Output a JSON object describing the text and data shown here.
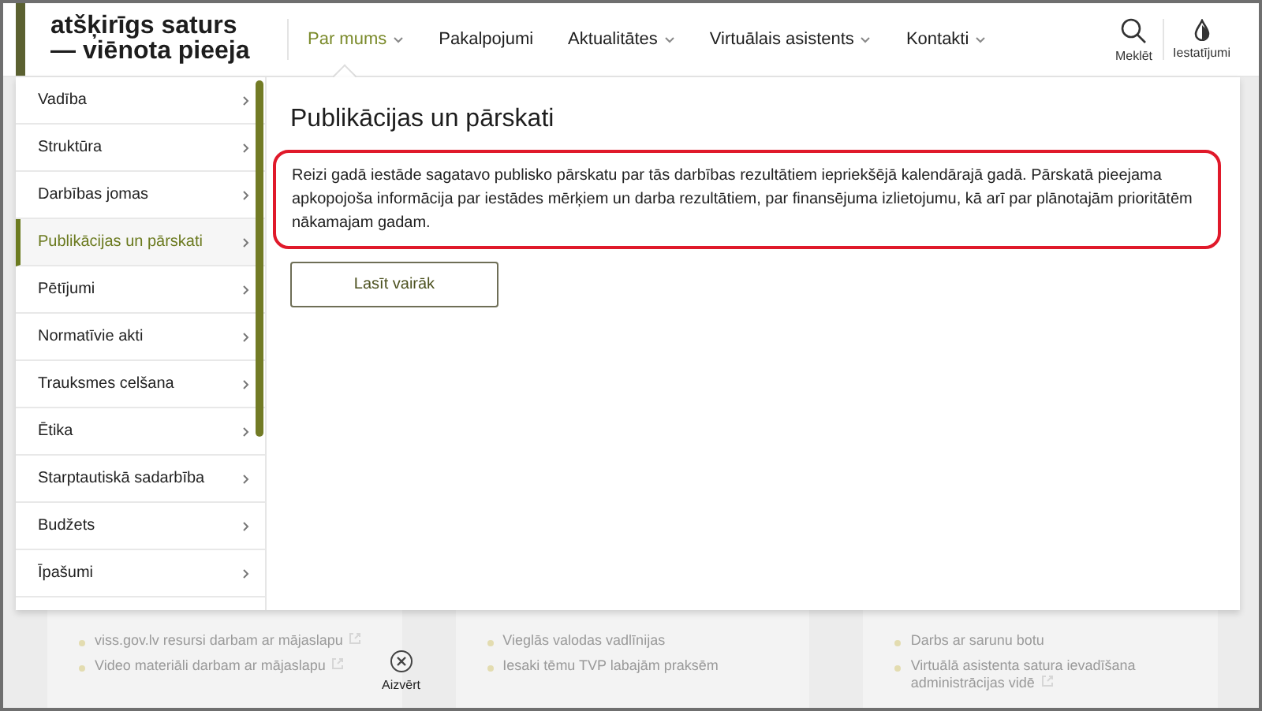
{
  "header": {
    "logo": [
      "atšķirīgs saturs",
      "— viēnota pieeja"
    ],
    "nav": [
      {
        "label": "Par mums",
        "selected": true,
        "dropdown": true
      },
      {
        "label": "Pakalpojumi",
        "selected": false,
        "dropdown": false
      },
      {
        "label": "Aktualitātes",
        "selected": false,
        "dropdown": true
      },
      {
        "label": "Virtuālais asistents",
        "selected": false,
        "dropdown": true
      },
      {
        "label": "Kontakti",
        "selected": false,
        "dropdown": true
      }
    ],
    "tools": [
      {
        "kind": "search",
        "label": "Meklēt"
      },
      {
        "kind": "settings",
        "label": "Iestatījumi"
      }
    ]
  },
  "submenu": [
    {
      "label": "Vadība",
      "selected": false
    },
    {
      "label": "Struktūra",
      "selected": false
    },
    {
      "label": "Darbības jomas",
      "selected": false
    },
    {
      "label": "Publikācijas un pārskati",
      "selected": true
    },
    {
      "label": "Pētījumi",
      "selected": false
    },
    {
      "label": "Normatīvie akti",
      "selected": false
    },
    {
      "label": "Trauksmes celšana",
      "selected": false
    },
    {
      "label": "Ētika",
      "selected": false
    },
    {
      "label": "Starptautiskā sadarbība",
      "selected": false
    },
    {
      "label": "Budžets",
      "selected": false
    },
    {
      "label": "Īpašumi",
      "selected": false
    }
  ],
  "panel": {
    "title": "Publikācijas un pārskati",
    "text": "Reizi gadā iestāde sagatavo publisko pārskatu par tās darbības rezultātiem iepriekšējā kalendārajā gadā. Pārskatā pieejama apkopojoša informācija par iestādes mērķiem un darba rezultātiem, par finansējuma izlietojumu, kā arī par plānotajām prioritātēm nākamajam gadam.",
    "button": "Lasīt vairāk"
  },
  "background_columns": [
    {
      "items": [
        {
          "text": "viss.gov.lv resursi darbam ar mājaslapu",
          "external": true
        },
        {
          "text": "Video materiāli darbam ar mājaslapu",
          "external": true
        }
      ]
    },
    {
      "items": [
        {
          "text": "Vieglās valodas vadlīnijas",
          "external": false
        },
        {
          "text": "Iesaki tēmu TVP labajām praksēm",
          "external": false
        }
      ]
    },
    {
      "items": [
        {
          "text": "Darbs ar sarunu botu",
          "external": false
        },
        {
          "text": "Virtuālā asistenta satura ievadīšana administrācijas vidē",
          "external": true
        }
      ]
    }
  ],
  "close": {
    "label": "Aizvērt"
  }
}
